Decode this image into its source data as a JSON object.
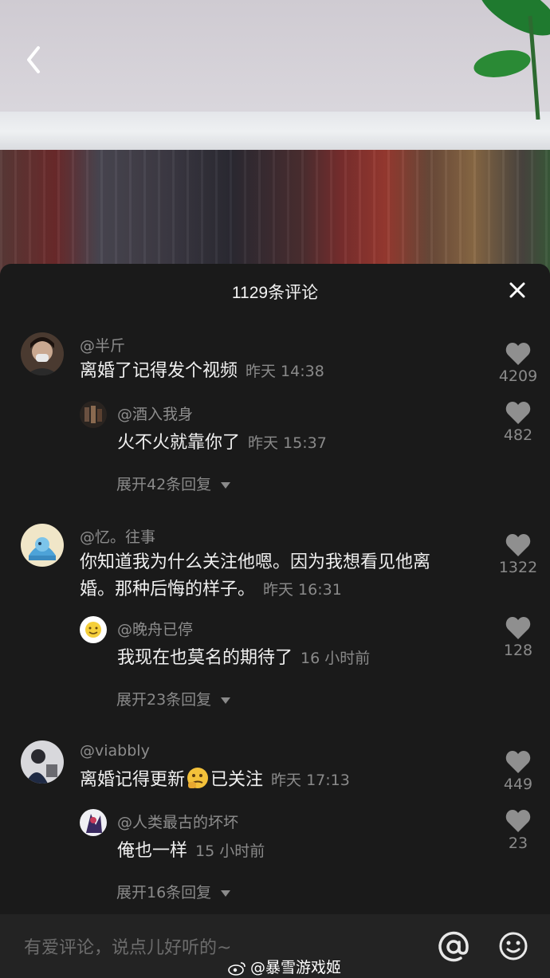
{
  "header": {
    "title": "1129条评论"
  },
  "comments": [
    {
      "username": "@半斤",
      "text": "离婚了记得发个视频",
      "time": "昨天 14:38",
      "likes": "4209",
      "reply": {
        "username": "@酒入我身",
        "text": "火不火就靠你了",
        "time": "昨天 15:37",
        "likes": "482"
      },
      "expand_label": "展开42条回复"
    },
    {
      "username": "@忆。往事",
      "text_line1": "你知道我为什么关注他嗯。因为我想看见他离",
      "text_line2": "婚。那种后悔的样子。",
      "time": "昨天 16:31",
      "likes": "1322",
      "reply": {
        "username": "@晚舟已停",
        "text": "我现在也莫名的期待了",
        "time": "16 小时前",
        "likes": "128"
      },
      "expand_label": "展开23条回复"
    },
    {
      "username": "@viabbly",
      "text_before_emoji": "离婚记得更新",
      "text_after_emoji": "已关注",
      "time": "昨天 17:13",
      "likes": "449",
      "reply": {
        "username": "@人类最古的坏坏",
        "text": "俺也一样",
        "time": "15 小时前",
        "likes": "23"
      },
      "expand_label": "展开16条回复"
    }
  ],
  "input": {
    "placeholder": "有爱评论，说点儿好听的~"
  },
  "watermark": "@暴雪游戏姬",
  "icons": {
    "back": "chevron-left-icon",
    "close": "close-icon",
    "like": "heart-icon",
    "mention": "at-icon",
    "emoji": "smiley-icon",
    "emoji_inline": "thinking-emoji-icon"
  },
  "colors": {
    "sheet_bg": "#1a1a1a",
    "secondary_text": "#8a8a8a",
    "primary_text": "#f0f0f0",
    "heart": "#8f8f8f"
  }
}
